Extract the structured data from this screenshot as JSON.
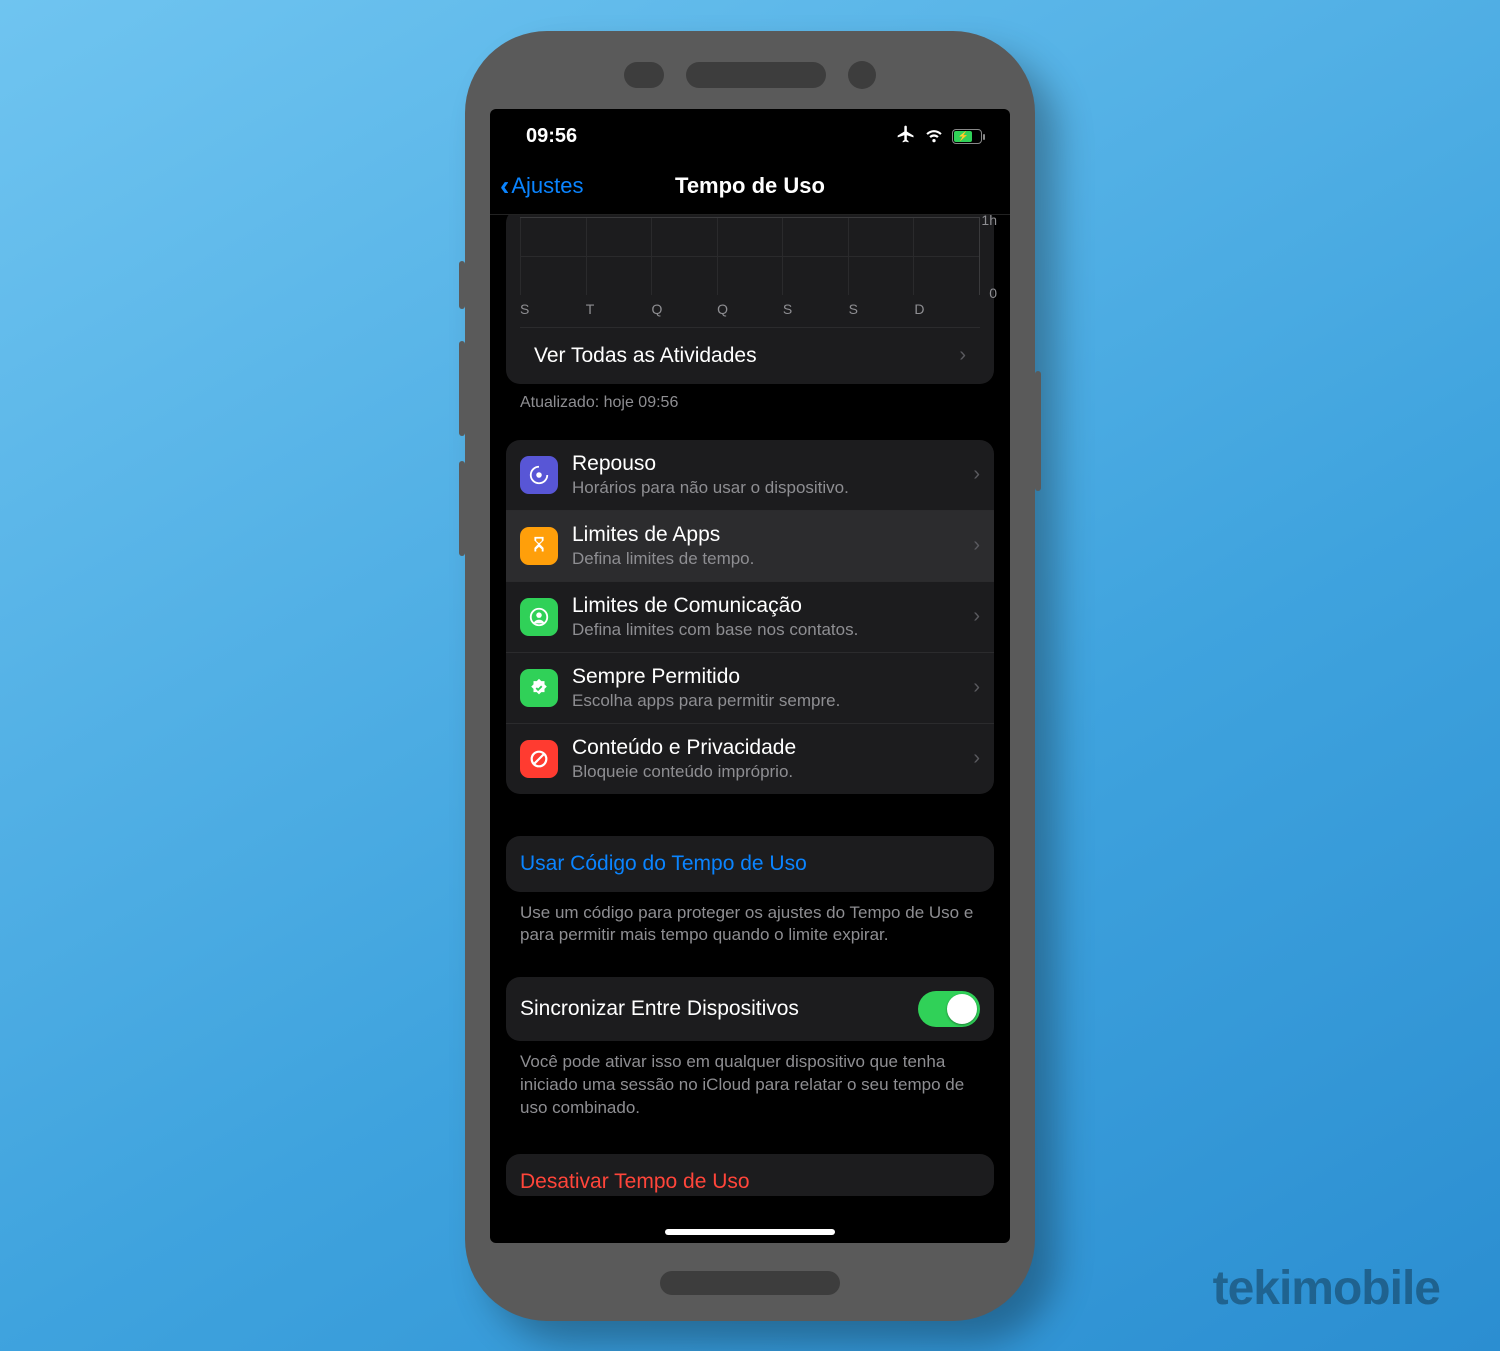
{
  "status": {
    "time": "09:56"
  },
  "nav": {
    "back": "Ajustes",
    "title": "Tempo de Uso"
  },
  "chart_data": {
    "type": "bar",
    "categories": [
      "S",
      "T",
      "Q",
      "Q",
      "S",
      "S",
      "D"
    ],
    "values": [
      0,
      0,
      0,
      0,
      0,
      0,
      0
    ],
    "yticks": [
      "1h",
      "0"
    ],
    "ylim": [
      0,
      1
    ]
  },
  "activities": {
    "link": "Ver Todas as Atividades",
    "updated": "Atualizado: hoje 09:56"
  },
  "settings": [
    {
      "key": "downtime",
      "title": "Repouso",
      "sub": "Horários para não usar o dispositivo.",
      "iconColor": "#5856d6"
    },
    {
      "key": "app-limits",
      "title": "Limites de Apps",
      "sub": "Defina limites de tempo.",
      "iconColor": "#ff9f0a",
      "highlight": true
    },
    {
      "key": "comm-limits",
      "title": "Limites de Comunicação",
      "sub": "Defina limites com base nos contatos.",
      "iconColor": "#30d158"
    },
    {
      "key": "always-allowed",
      "title": "Sempre Permitido",
      "sub": "Escolha apps para permitir sempre.",
      "iconColor": "#30d158"
    },
    {
      "key": "content-privacy",
      "title": "Conteúdo e Privacidade",
      "sub": "Bloqueie conteúdo impróprio.",
      "iconColor": "#ff3b30"
    }
  ],
  "passcode": {
    "link": "Usar Código do Tempo de Uso",
    "help": "Use um código para proteger os ajustes do Tempo de Uso e para permitir mais tempo quando o limite expirar."
  },
  "share": {
    "label": "Sincronizar Entre Dispositivos",
    "enabled": true,
    "help": "Você pode ativar isso em qualquer dispositivo que tenha iniciado uma sessão no iCloud para relatar o seu tempo de uso combinado."
  },
  "disable": {
    "label": "Desativar Tempo de Uso"
  },
  "watermark": "tekimobile"
}
